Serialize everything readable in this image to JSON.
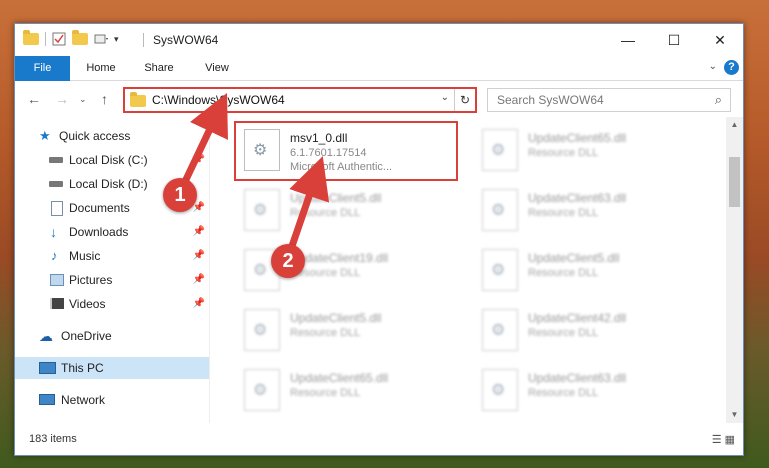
{
  "window": {
    "title": "SysWOW64"
  },
  "window_buttons": {
    "minimize": "—",
    "maximize": "☐",
    "close": "✕"
  },
  "ribbon": {
    "tabs": [
      "File",
      "Home",
      "Share",
      "View"
    ],
    "help": "?"
  },
  "address": {
    "path": "C:\\Windows\\SysWOW64"
  },
  "search": {
    "placeholder": "Search SysWOW64"
  },
  "nav": {
    "items": [
      {
        "label": "Quick access",
        "icon": "star-icon"
      },
      {
        "label": "Local Disk (C:)",
        "icon": "drive-icon"
      },
      {
        "label": "Local Disk (D:)",
        "icon": "drive-icon"
      },
      {
        "label": "Documents",
        "icon": "documents-icon"
      },
      {
        "label": "Downloads",
        "icon": "download-icon"
      },
      {
        "label": "Music",
        "icon": "music-icon"
      },
      {
        "label": "Pictures",
        "icon": "pictures-icon"
      },
      {
        "label": "Videos",
        "icon": "videos-icon"
      },
      {
        "label": "OneDrive",
        "icon": "cloud-icon"
      },
      {
        "label": "This PC",
        "icon": "computer-icon"
      },
      {
        "label": "Network",
        "icon": "network-icon"
      }
    ]
  },
  "files": {
    "highlighted": {
      "name": "msv1_0.dll",
      "version": "6.1.7601.17514",
      "company": "Microsoft Authentic..."
    },
    "left_column": [
      {
        "name": "UpdateClient5.dll",
        "type": "Resource DLL"
      },
      {
        "name": "UpdateClient19.dll",
        "type": "Resource DLL"
      },
      {
        "name": "UpdateClient5.dll",
        "type": "Resource DLL"
      },
      {
        "name": "UpdateClient65.dll",
        "type": "Resource DLL"
      }
    ],
    "right_column": [
      {
        "name": "UpdateClient65.dll",
        "type": "Resource DLL"
      },
      {
        "name": "UpdateClient63.dll",
        "type": "Resource DLL"
      },
      {
        "name": "UpdateClient5.dll",
        "type": "Resource DLL"
      },
      {
        "name": "UpdateClient42.dll",
        "type": "Resource DLL"
      },
      {
        "name": "UpdateClient63.dll",
        "type": "Resource DLL"
      }
    ]
  },
  "status": {
    "count": "183 items"
  },
  "annotations": {
    "step1": "1",
    "step2": "2"
  },
  "colors": {
    "accent": "#1979ca",
    "highlight": "#d9403a"
  }
}
